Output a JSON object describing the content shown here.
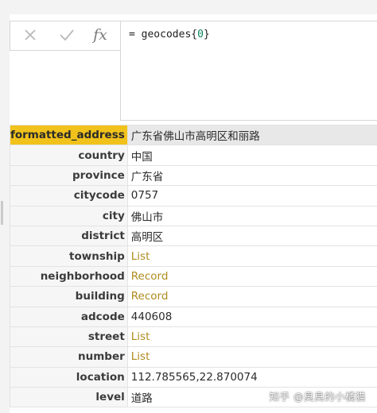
{
  "formula_bar": {
    "cancel_icon": "close-x-icon",
    "confirm_icon": "checkmark-icon",
    "fx_label": "fx",
    "formula_prefix": "= geocodes{",
    "formula_index": "0",
    "formula_suffix": "}"
  },
  "record": [
    {
      "key": "formatted_address",
      "value": "广东省佛山市高明区和丽路",
      "type": "text",
      "selected": true
    },
    {
      "key": "country",
      "value": "中国",
      "type": "text"
    },
    {
      "key": "province",
      "value": "广东省",
      "type": "text"
    },
    {
      "key": "citycode",
      "value": "0757",
      "type": "text"
    },
    {
      "key": "city",
      "value": "佛山市",
      "type": "text"
    },
    {
      "key": "district",
      "value": "高明区",
      "type": "text"
    },
    {
      "key": "township",
      "value": "List",
      "type": "link"
    },
    {
      "key": "neighborhood",
      "value": "Record",
      "type": "link"
    },
    {
      "key": "building",
      "value": "Record",
      "type": "link"
    },
    {
      "key": "adcode",
      "value": "440608",
      "type": "text"
    },
    {
      "key": "street",
      "value": "List",
      "type": "link"
    },
    {
      "key": "number",
      "value": "List",
      "type": "link"
    },
    {
      "key": "location",
      "value": "112.785565,22.870074",
      "type": "text"
    },
    {
      "key": "level",
      "value": "道路",
      "type": "text"
    }
  ],
  "watermark": "知乎 @臭臭的小橘猫",
  "colors": {
    "selected_key_bg": "#f1c21b",
    "link_text": "#b08c20"
  }
}
